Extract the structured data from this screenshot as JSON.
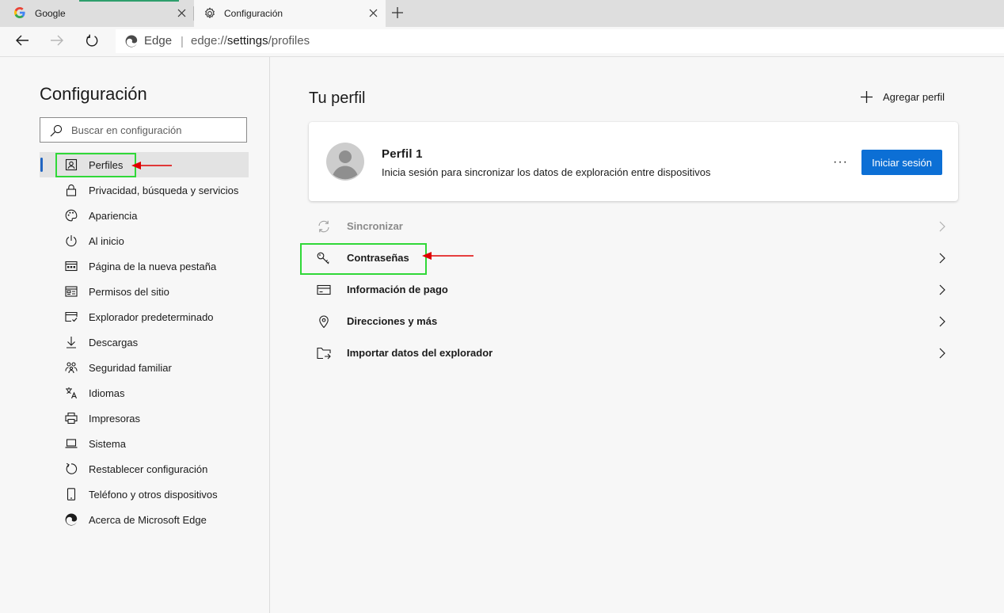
{
  "tabs": [
    {
      "title": "Google",
      "favicon": "google-g-icon",
      "active": false
    },
    {
      "title": "Configuración",
      "favicon": "gear-icon",
      "active": true
    }
  ],
  "address_bar": {
    "site_label": "Edge",
    "url_prefix": "edge://",
    "url_strong": "settings",
    "url_suffix": "/profiles"
  },
  "sidebar": {
    "title": "Configuración",
    "search_placeholder": "Buscar en configuración",
    "items": [
      {
        "label": "Perfiles",
        "icon": "profile-card-icon",
        "active": true
      },
      {
        "label": "Privacidad, búsqueda y servicios",
        "icon": "lock-icon"
      },
      {
        "label": "Apariencia",
        "icon": "palette-icon"
      },
      {
        "label": "Al inicio",
        "icon": "power-icon"
      },
      {
        "label": "Página de la nueva pestaña",
        "icon": "new-tab-page-icon"
      },
      {
        "label": "Permisos del sitio",
        "icon": "site-permissions-icon"
      },
      {
        "label": "Explorador predeterminado",
        "icon": "default-browser-icon"
      },
      {
        "label": "Descargas",
        "icon": "download-icon"
      },
      {
        "label": "Seguridad familiar",
        "icon": "family-icon"
      },
      {
        "label": "Idiomas",
        "icon": "languages-icon"
      },
      {
        "label": "Impresoras",
        "icon": "printer-icon"
      },
      {
        "label": "Sistema",
        "icon": "laptop-icon"
      },
      {
        "label": "Restablecer configuración",
        "icon": "reset-icon"
      },
      {
        "label": "Teléfono y otros dispositivos",
        "icon": "phone-icon"
      },
      {
        "label": "Acerca de Microsoft Edge",
        "icon": "edge-logo-icon"
      }
    ]
  },
  "main": {
    "title": "Tu perfil",
    "add_profile_label": "Agregar perfil",
    "profile": {
      "name": "Perfil 1",
      "description": "Inicia sesión para sincronizar los datos de exploración entre dispositivos",
      "more_label": "···",
      "signin_label": "Iniciar sesión"
    },
    "rows": [
      {
        "label": "Sincronizar",
        "icon": "sync-icon",
        "disabled": true
      },
      {
        "label": "Contraseñas",
        "icon": "key-icon"
      },
      {
        "label": "Información de pago",
        "icon": "credit-card-icon"
      },
      {
        "label": "Direcciones y más",
        "icon": "location-pin-icon"
      },
      {
        "label": "Importar datos del explorador",
        "icon": "import-folder-icon"
      }
    ]
  },
  "colors": {
    "accent": "#0c6fd5",
    "highlight_box": "#30d838",
    "annotation_arrow": "#e00000",
    "active_indicator": "#2266c2"
  }
}
